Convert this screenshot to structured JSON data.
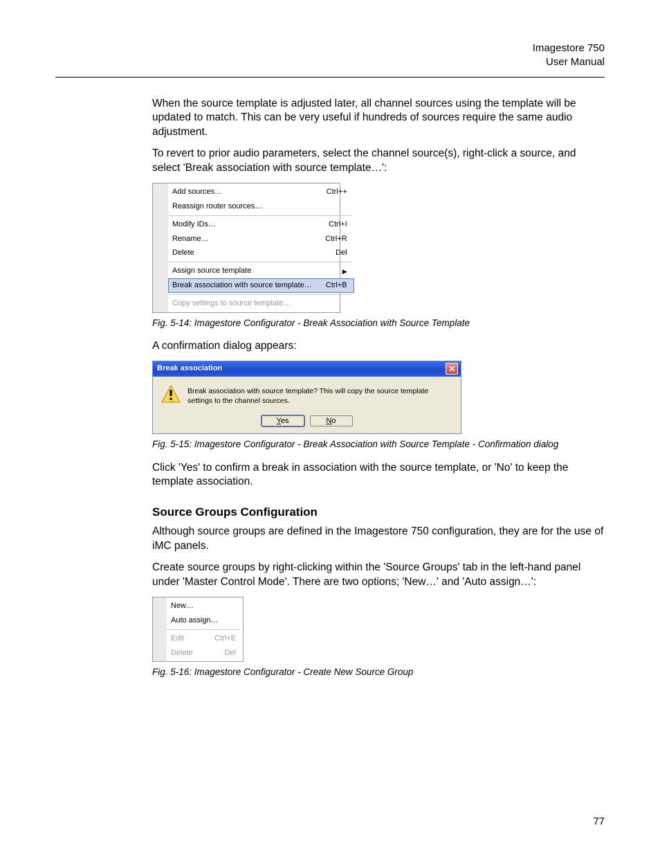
{
  "header": {
    "product": "Imagestore 750",
    "doc": "User Manual"
  },
  "para1": "When the source template is adjusted later, all channel sources using the template will be updated to match. This can be very useful if hundreds of sources require the same audio adjustment.",
  "para2": "To revert to prior audio parameters, select the channel source(s), right-click a source, and select 'Break association with source template…':",
  "fig14": {
    "menu": {
      "add_sources": "Add sources…",
      "add_sources_sc": "Ctrl++",
      "reassign": "Reassign router sources…",
      "modify_ids": "Modify IDs…",
      "modify_ids_sc": "Ctrl+I",
      "rename": "Rename…",
      "rename_sc": "Ctrl+R",
      "delete": "Delete",
      "delete_sc": "Del",
      "assign": "Assign source template",
      "break": "Break association with source template…",
      "break_sc": "Ctrl+B",
      "copy": "Copy settings to source template…"
    },
    "caption": "Fig. 5-14: Imagestore Configurator - Break Association with Source Template"
  },
  "para3": "A confirmation dialog appears:",
  "fig15": {
    "title": "Break association",
    "message": "Break association with source template? This will copy the source template settings to the channel sources.",
    "yes": "Yes",
    "no": "No",
    "caption": "Fig. 5-15: Imagestore Configurator - Break Association with Source Template - Confirmation dialog"
  },
  "para4": "Click 'Yes' to confirm a break in association with the source template, or 'No' to keep the template association.",
  "section_heading": "Source Groups Configuration",
  "para5": "Although source groups are defined in the Imagestore 750 configuration, they are for the use of iMC panels.",
  "para6": "Create source groups by right-clicking within the 'Source Groups' tab in the left-hand panel under 'Master Control Mode'. There are two options; 'New…' and 'Auto assign…':",
  "fig16": {
    "menu": {
      "new": "New…",
      "auto": "Auto assign…",
      "edit": "Edit",
      "edit_sc": "Ctrl+E",
      "delete": "Delete",
      "delete_sc": "Del"
    },
    "caption": "Fig. 5-16: Imagestore Configurator - Create New Source Group"
  },
  "page_number": "77"
}
